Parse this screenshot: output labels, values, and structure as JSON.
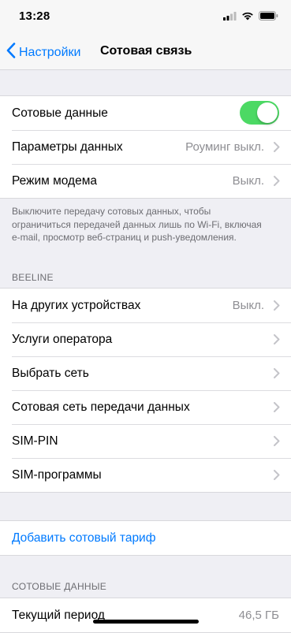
{
  "status_bar": {
    "time": "13:28"
  },
  "nav": {
    "back_label": "Настройки",
    "title": "Сотовая связь"
  },
  "cellular_group": {
    "items": [
      {
        "label": "Сотовые данные",
        "toggle_on": true
      },
      {
        "label": "Параметры данных",
        "value": "Роуминг выкл."
      },
      {
        "label": "Режим модема",
        "value": "Выкл."
      }
    ]
  },
  "cellular_footnote": "Выключите передачу сотовых данных, чтобы ограничиться передачей данных лишь по Wi-Fi, включая e-mail, просмотр веб-страниц и push-уведомления.",
  "carrier_section": {
    "header": "BEELINE",
    "items": [
      {
        "label": "На других устройствах",
        "value": "Выкл."
      },
      {
        "label": "Услуги оператора"
      },
      {
        "label": "Выбрать сеть"
      },
      {
        "label": "Сотовая сеть передачи данных"
      },
      {
        "label": "SIM-PIN"
      },
      {
        "label": "SIM-программы"
      }
    ]
  },
  "add_plan": {
    "label": "Добавить сотовый тариф"
  },
  "usage_section": {
    "header": "СОТОВЫЕ ДАННЫЕ",
    "items": [
      {
        "label": "Текущий период",
        "value": "46,5 ГБ"
      }
    ]
  },
  "colors": {
    "accent": "#007aff",
    "toggle_on": "#4cd964",
    "background": "#efeff4"
  }
}
